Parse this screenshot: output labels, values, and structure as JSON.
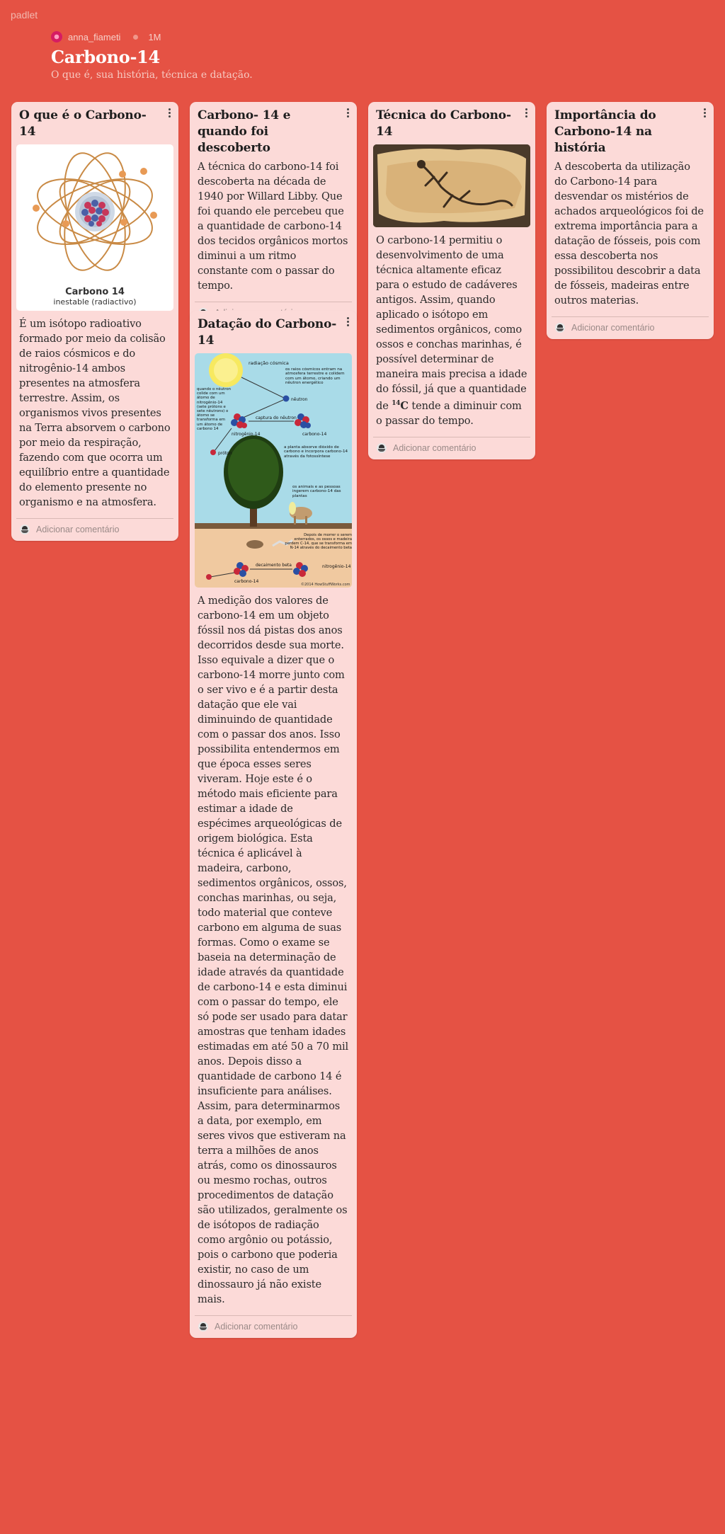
{
  "brand": "padlet",
  "header": {
    "author": "anna_fiameti",
    "age": "1M",
    "title": "Carbono-14",
    "subtitle": "O que é, sua história, técnica e datação."
  },
  "comment_placeholder": "Adicionar comentário",
  "cards": [
    {
      "title": "O que é o Carbono-14",
      "image_caption_line1": "Carbono 14",
      "image_caption_line2": "inestable (radiactivo)",
      "body": "É um isótopo radioativo formado por meio da colisão de raios cósmicos e do nitrogênio-14 ambos presentes na atmosfera terrestre. Assim, os organismos vivos presentes na Terra absorvem o carbono por meio da respiração, fazendo com que ocorra um equilíbrio entre a quantidade do elemento presente no organismo e na atmosfera."
    },
    {
      "title": "Carbono- 14 e quando foi descoberto",
      "body": "A técnica do carbono-14 foi descoberta na década de 1940 por Willard Libby. Que foi quando ele percebeu que a quantidade de carbono-14 dos tecidos orgânicos mortos diminui a um ritmo constante com o passar do tempo."
    },
    {
      "title": "Datação do Carbono-14",
      "diagram": {
        "l1": "radiação cósmica",
        "l2": "os raios cósmicos entram na atmosfera terrestre e colidem com um átomo, criando um nêutron energético",
        "l3": "quando o nêutron colide com um átomo de nitrogênio-14 (sete prótons e sete nêutrons) o átomo se transforma em um átomo de carbono 14",
        "l4": "nêutron",
        "l5": "captura do nêutron",
        "l6": "nitrogênio-14",
        "l7": "carbono-14",
        "l8": "próton",
        "l9": "a planta absorve dióxido de carbono e incorpora carbono-14 através da fotossíntese",
        "l10": "os animais e as pessoas ingerem carbono-14 das plantas",
        "l11": "Depois de morrer o serem enterrados, os ossos e madeira perdem C-14, que se transforma em N-14 através do decaimento beta",
        "l12": "decaimento beta",
        "l13": "nitrogênio-14",
        "l14": "carbono-14",
        "l15": "©2014 HowStuffWorks.com"
      },
      "body": "A medição dos valores de carbono-14 em um objeto fóssil nos dá pistas dos anos decorridos desde sua morte. Isso equivale a dizer que o carbono-14 morre junto com o ser vivo e é a partir desta datação que ele vai diminuindo de quantidade com o passar dos anos. Isso possibilita entendermos em que época esses seres viveram. Hoje este é o método mais eficiente para estimar a idade de espécimes arqueológicas de origem biológica. Esta técnica é aplicável à madeira, carbono, sedimentos orgânicos, ossos, conchas marinhas, ou seja, todo material que conteve carbono em alguma de suas formas. Como o exame se baseia na determinação de idade através da quantidade de carbono-14 e esta diminui com o passar do tempo, ele só pode ser usado para datar amostras que tenham idades estimadas em até 50 a 70 mil anos. Depois disso a quantidade de carbono 14 é insuficiente para análises. Assim, para determinarmos a data, por exemplo, em seres vivos que estiveram na terra a milhões de anos atrás, como os dinossauros ou mesmo rochas, outros procedimentos de datação são utilizados, geralmente os de isótopos de radiação como argônio ou potássio, pois o carbono que poderia existir, no caso de um dinossauro já não existe mais."
    },
    {
      "title": "Técnica do Carbono-14",
      "body_main": "O carbono-14 permitiu o desenvolvimento de uma técnica altamente eficaz para o estudo de cadáveres antigos. Assim, quando aplicado o isótopo em sedimentos orgânicos, como ossos e conchas marinhas, é possível determinar de maneira mais precisa a idade do fóssil, já que a quantidade de",
      "sup": "14",
      "element": "C",
      "body_end": "tende a diminuir com o passar do tempo."
    },
    {
      "title": "Importância do Carbono-14 na história",
      "body": "A descoberta da utilização do Carbono-14 para desvendar os mistérios de achados arqueológicos foi de extrema importância para a datação de fósseis, pois com essa descoberta nos possibilitou descobrir a data de fósseis, madeiras entre outros materias."
    }
  ]
}
